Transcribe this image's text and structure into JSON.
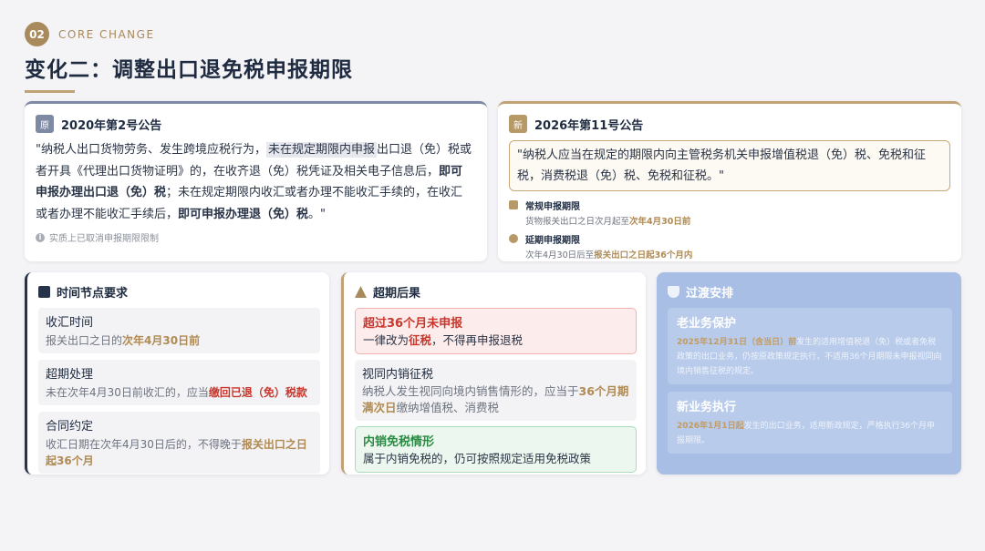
{
  "header": {
    "section_number": "02",
    "core_label": "CORE CHANGE",
    "title": "变化二：调整出口退免税申报期限"
  },
  "old": {
    "tag": "原",
    "title": "2020年第2号公告",
    "body_1": "\"纳税人出口货物劳务、发生跨境应税行为，",
    "body_hl": "未在规定期限内申报",
    "body_2": "出口退（免）税或者开具《代理出口货物证明》的，在收齐退（免）税凭证及相关电子信息后，",
    "body_bold1": "即可申报办理出口退（免）税",
    "body_3": "；未在规定期限内收汇或者办理不能收汇手续的，在收汇或者办理不能收汇手续后，",
    "body_bold2": "即可申报办理退（免）税",
    "body_end": "。\"",
    "note": "实质上已取消申报期限限制"
  },
  "new": {
    "tag": "新",
    "title": "2026年第11号公告",
    "quote": "\"纳税人应当在规定的期限内向主管税务机关申报增值税退（免）税、免税和征税，消费税退（免）税、免税和征税。\"",
    "regular": {
      "title": "常规申报期限",
      "desc_prefix": "货物报关出口之日次月起至",
      "desc_hl": "次年4月30日前"
    },
    "extended": {
      "title": "延期申报期限",
      "desc_prefix": "次年4月30日后至",
      "desc_hl": "报关出口之日起36个月内"
    }
  },
  "time_nodes": {
    "title": "时间节点要求",
    "items": [
      {
        "label": "收汇时间",
        "desc_prefix": "报关出口之日的",
        "desc_hl": "次年4月30日前",
        "desc_suffix": ""
      },
      {
        "label": "超期处理",
        "desc_prefix": "未在次年4月30日前收汇的，应当",
        "desc_hl": "缴回已退（免）税款",
        "desc_suffix": ""
      },
      {
        "label": "合同约定",
        "desc_prefix": "收汇日期在次年4月30日后的，不得晚于",
        "desc_hl": "报关出口之日起36个月",
        "desc_suffix": ""
      }
    ]
  },
  "consequences": {
    "title": "超期后果",
    "over36": {
      "title": "超过36个月未申报",
      "desc_prefix": "一律改为",
      "desc_hl": "征税",
      "desc_suffix": "，不得再申报退税"
    },
    "deemed": {
      "title": "视同内销征税",
      "desc_prefix": "纳税人发生视同向境内销售情形的，应当于",
      "desc_hl": "36个月期满次日",
      "desc_suffix": "缴纳增值税、消费税"
    },
    "exempt": {
      "title": "内销免税情形",
      "desc": "属于内销免税的，仍可按照规定适用免税政策"
    }
  },
  "transition": {
    "title": "过渡安排",
    "old_business": {
      "title": "老业务保护",
      "desc_hl": "2025年12月31日（含当日）前",
      "desc_suffix": "发生的适用增值税退（免）税或者免税政策的出口业务，仍按原政策规定执行，不适用36个月期限未申报视同向境内销售征税的规定。"
    },
    "new_business": {
      "title": "新业务执行",
      "desc_hl": "2026年1月1日起",
      "desc_suffix": "发生的出口业务，适用新政规定，严格执行36个月申报期限。"
    }
  },
  "colors": {
    "gold": "#b08a52",
    "navy": "#1e2b40",
    "red": "#c8372d",
    "green": "#2b8a43",
    "blue_panel": "#a9bee5"
  }
}
